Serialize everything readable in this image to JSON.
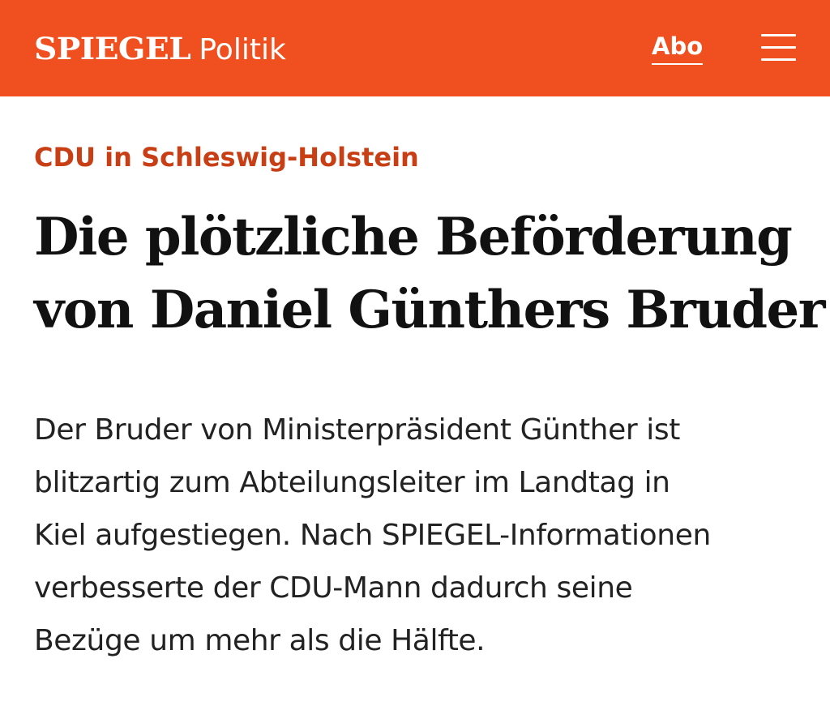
{
  "header": {
    "logo": "SPIEGEL",
    "section": "Politik",
    "abo_label": "Abo",
    "menu_icon": "hamburger-menu-icon",
    "background_color": "#f0501f"
  },
  "article": {
    "kicker": "CDU in Schleswig-Holstein",
    "kicker_color": "#c83f16",
    "headline_lines": [
      "Die plötzliche Beförderung",
      "von Daniel Günthers Bruder"
    ],
    "teaser_lines": [
      "Der Bruder von Ministerpräsident Günther ist",
      "blitzartig zum Abteilungsleiter im Landtag in",
      "Kiel aufgestiegen. Nach SPIEGEL-Informationen",
      "verbesserte der CDU-Mann dadurch seine",
      "Bezüge um mehr als die Hälfte."
    ]
  }
}
